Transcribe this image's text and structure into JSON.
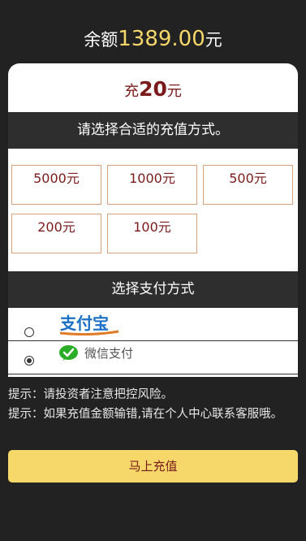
{
  "balance": {
    "label": "余额",
    "amount": "1389.00",
    "unit": "元"
  },
  "recharge": {
    "label": "充",
    "amount": "20",
    "unit": "元"
  },
  "choose_amount_title": "请选择合适的充值方式。",
  "amount_options": [
    "5000元",
    "1000元",
    "500元",
    "200元",
    "100元"
  ],
  "choose_payment_title": "选择支付方式",
  "payment_methods": [
    {
      "name": "支付宝",
      "icon": "alipay-logo",
      "selected": false
    },
    {
      "name": "微信支付",
      "icon": "wechat-pay-icon",
      "selected": true
    }
  ],
  "tips": [
    "提示：请投资者注意把控风险。",
    "提示：如果充值金额输错,请在个人中心联系客服哦。"
  ],
  "submit_label": "马上充值",
  "colors": {
    "background": "#222222",
    "accent": "#f5d76a",
    "primary_text": "#7a1a1a",
    "border": "#d6a07a"
  }
}
